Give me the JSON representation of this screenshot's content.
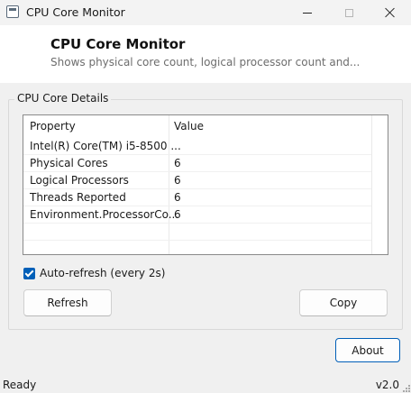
{
  "window": {
    "title": "CPU Core Monitor"
  },
  "header": {
    "title": "CPU Core Monitor",
    "subtitle": "Shows physical core count, logical processor count and..."
  },
  "group": {
    "label": "CPU Core Details"
  },
  "table": {
    "columns": [
      "Property",
      "Value"
    ],
    "rows": [
      {
        "property": "Intel(R) Core(TM) i5-8500 ...",
        "value": ""
      },
      {
        "property": "Physical Cores",
        "value": "6"
      },
      {
        "property": "Logical Processors",
        "value": "6"
      },
      {
        "property": "Threads Reported",
        "value": "6"
      },
      {
        "property": "Environment.ProcessorCo...",
        "value": "6"
      }
    ]
  },
  "auto_refresh": {
    "label": "Auto-refresh (every 2s)",
    "checked": true
  },
  "buttons": {
    "refresh": "Refresh",
    "copy": "Copy",
    "about": "About"
  },
  "status": {
    "left": "Ready",
    "right": "v2.0"
  },
  "colors": {
    "accent": "#005fb8",
    "header_bg": "#ffffff",
    "window_bg": "#f0f0f0"
  }
}
